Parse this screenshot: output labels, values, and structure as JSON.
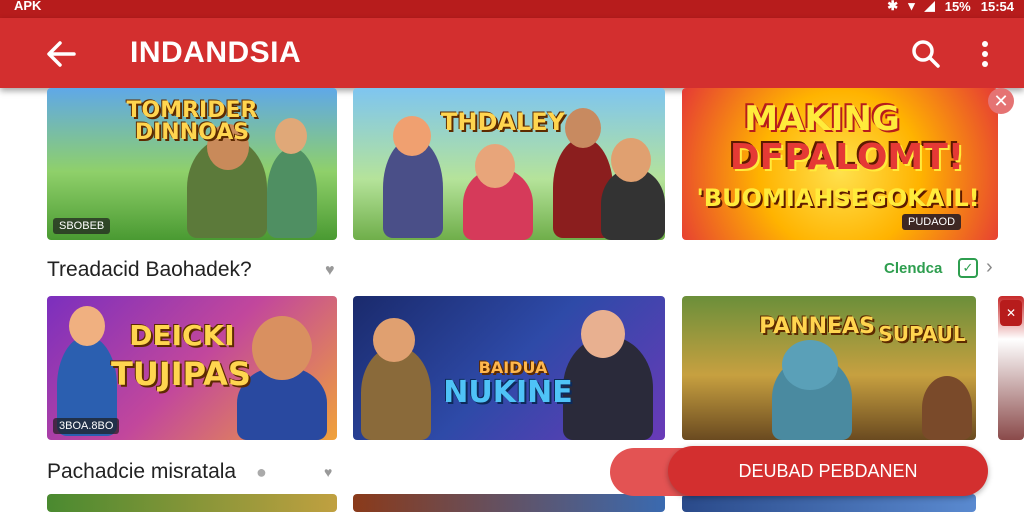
{
  "status_bar": {
    "carrier": "APK",
    "battery": "15%",
    "time": "15:54"
  },
  "app_bar": {
    "title": "INDANDSIA"
  },
  "row1": {
    "cards": [
      {
        "title": "TOMRIDER DINNOAS",
        "badge": "SBOBEB"
      },
      {
        "title": "THDALEY",
        "badge": ""
      },
      {
        "title_line1": "MAKING",
        "title_line2": "DFPALOMT!",
        "title_line3": "'BUOMIAHSEGOKAIL!",
        "badge": "PUDAOD"
      }
    ]
  },
  "section1": {
    "title": "Treadacid Baohadek?",
    "see_all": "Clendca"
  },
  "row2": {
    "cards": [
      {
        "title_line1": "DEICKI",
        "title_line2": "TUJIPAS",
        "badge": "3BOA.8BO"
      },
      {
        "title_line1": "BAIDUA",
        "title_line2": "NUKINE"
      },
      {
        "title_line1": "PANNEAS",
        "title_line2": "SUPAUL"
      }
    ]
  },
  "section2": {
    "title": "Pachadcie misratala"
  },
  "cta": {
    "label": "DEUBAD PEBDANEN"
  },
  "colors": {
    "primary": "#d32f2f",
    "status": "#b71c1c",
    "accent_green": "#2e9e4f"
  }
}
